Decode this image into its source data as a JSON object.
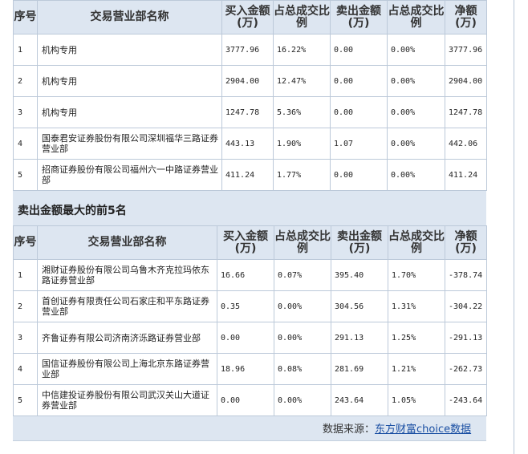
{
  "buy_table": {
    "headers": [
      "序号",
      "交易营业部名称",
      "买入金额(万)",
      "占总成交比例",
      "卖出金额(万)",
      "占总成交比例",
      "净额(万)"
    ],
    "rows": [
      {
        "idx": "1",
        "name": "机构专用",
        "buy": "3777.96",
        "buy_pct": "16.22%",
        "sell": "0.00",
        "sell_pct": "0.00%",
        "net": "3777.96"
      },
      {
        "idx": "2",
        "name": "机构专用",
        "buy": "2904.00",
        "buy_pct": "12.47%",
        "sell": "0.00",
        "sell_pct": "0.00%",
        "net": "2904.00"
      },
      {
        "idx": "3",
        "name": "机构专用",
        "buy": "1247.78",
        "buy_pct": "5.36%",
        "sell": "0.00",
        "sell_pct": "0.00%",
        "net": "1247.78"
      },
      {
        "idx": "4",
        "name": "国泰君安证券股份有限公司深圳福华三路证券营业部",
        "buy": "443.13",
        "buy_pct": "1.90%",
        "sell": "1.07",
        "sell_pct": "0.00%",
        "net": "442.06"
      },
      {
        "idx": "5",
        "name": "招商证券股份有限公司福州六一中路证券营业部",
        "buy": "411.24",
        "buy_pct": "1.77%",
        "sell": "0.00",
        "sell_pct": "0.00%",
        "net": "411.24"
      }
    ]
  },
  "sell_section_title": "卖出金额最大的前5名",
  "sell_table": {
    "headers": [
      "序号",
      "交易营业部名称",
      "买入金额(万)",
      "占总成交比例",
      "卖出金额(万)",
      "占总成交比例",
      "净额(万)"
    ],
    "rows": [
      {
        "idx": "1",
        "name": "湘财证券股份有限公司乌鲁木齐克拉玛依东路证券营业部",
        "buy": "16.66",
        "buy_pct": "0.07%",
        "sell": "395.40",
        "sell_pct": "1.70%",
        "net": "-378.74"
      },
      {
        "idx": "2",
        "name": "首创证券有限责任公司石家庄和平东路证券营业部",
        "buy": "0.35",
        "buy_pct": "0.00%",
        "sell": "304.56",
        "sell_pct": "1.31%",
        "net": "-304.22"
      },
      {
        "idx": "3",
        "name": "齐鲁证券有限公司济南济泺路证券营业部",
        "buy": "0.00",
        "buy_pct": "0.00%",
        "sell": "291.13",
        "sell_pct": "1.25%",
        "net": "-291.13"
      },
      {
        "idx": "4",
        "name": "国信证券股份有限公司上海北京东路证券营业部",
        "buy": "18.96",
        "buy_pct": "0.08%",
        "sell": "281.69",
        "sell_pct": "1.21%",
        "net": "-262.73"
      },
      {
        "idx": "5",
        "name": "中信建投证券股份有限公司武汉关山大道证券营业部",
        "buy": "0.00",
        "buy_pct": "0.00%",
        "sell": "243.64",
        "sell_pct": "1.05%",
        "net": "-243.64"
      }
    ]
  },
  "footer": {
    "source_label": "数据来源：",
    "source_link": "东方财富choice数据"
  }
}
